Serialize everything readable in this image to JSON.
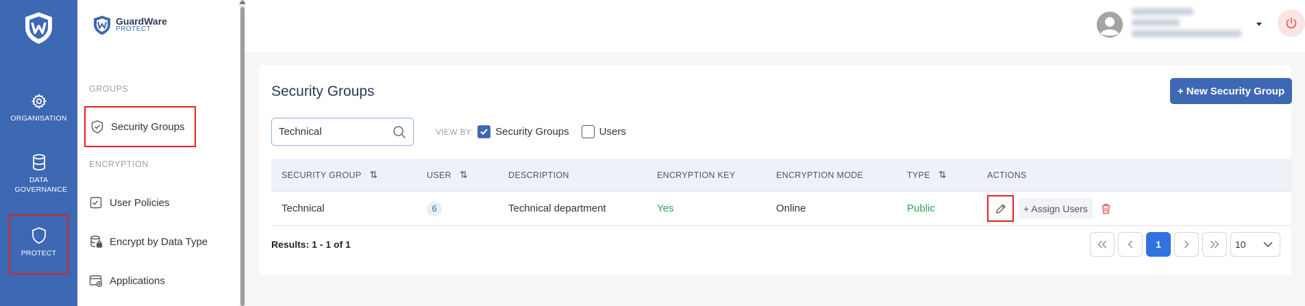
{
  "rail": {
    "items": [
      {
        "label": "ORGANISATION"
      },
      {
        "label": "DATA GOVERNANCE"
      },
      {
        "label": "PROTECT"
      }
    ]
  },
  "sidebar": {
    "brand_name": "GuardWare",
    "brand_sub": "PROTECT",
    "sections": [
      "GROUPS",
      "ENCRYPTION"
    ],
    "items": [
      {
        "label": "Security Groups",
        "icon": "shield-check-icon"
      },
      {
        "label": "User Policies",
        "icon": "checklist-icon"
      },
      {
        "label": "Encrypt by Data Type",
        "icon": "database-lock-icon"
      },
      {
        "label": "Applications",
        "icon": "app-window-icon"
      }
    ]
  },
  "page": {
    "title": "Security Groups",
    "new_button": "+ New Security Group",
    "search_value": "Technical",
    "view_by_label": "VIEW BY:",
    "view_by_options": [
      {
        "label": "Security Groups",
        "checked": true
      },
      {
        "label": "Users",
        "checked": false
      }
    ]
  },
  "table": {
    "columns": [
      "SECURITY GROUP",
      "USER",
      "DESCRIPTION",
      "ENCRYPTION KEY",
      "ENCRYPTION MODE",
      "TYPE",
      "ACTIONS"
    ],
    "rows": [
      {
        "security_group": "Technical",
        "user": "6",
        "description": "Technical department",
        "encryption_key": "Yes",
        "encryption_mode": "Online",
        "type": "Public",
        "assign_label": "+ Assign Users"
      }
    ]
  },
  "pagination": {
    "results_text": "Results: 1 - 1 of 1",
    "current_page": "1",
    "page_size": "10"
  },
  "colors": {
    "brand": "#3d68b3",
    "highlight": "#e02020",
    "positive": "#2aa35a"
  }
}
